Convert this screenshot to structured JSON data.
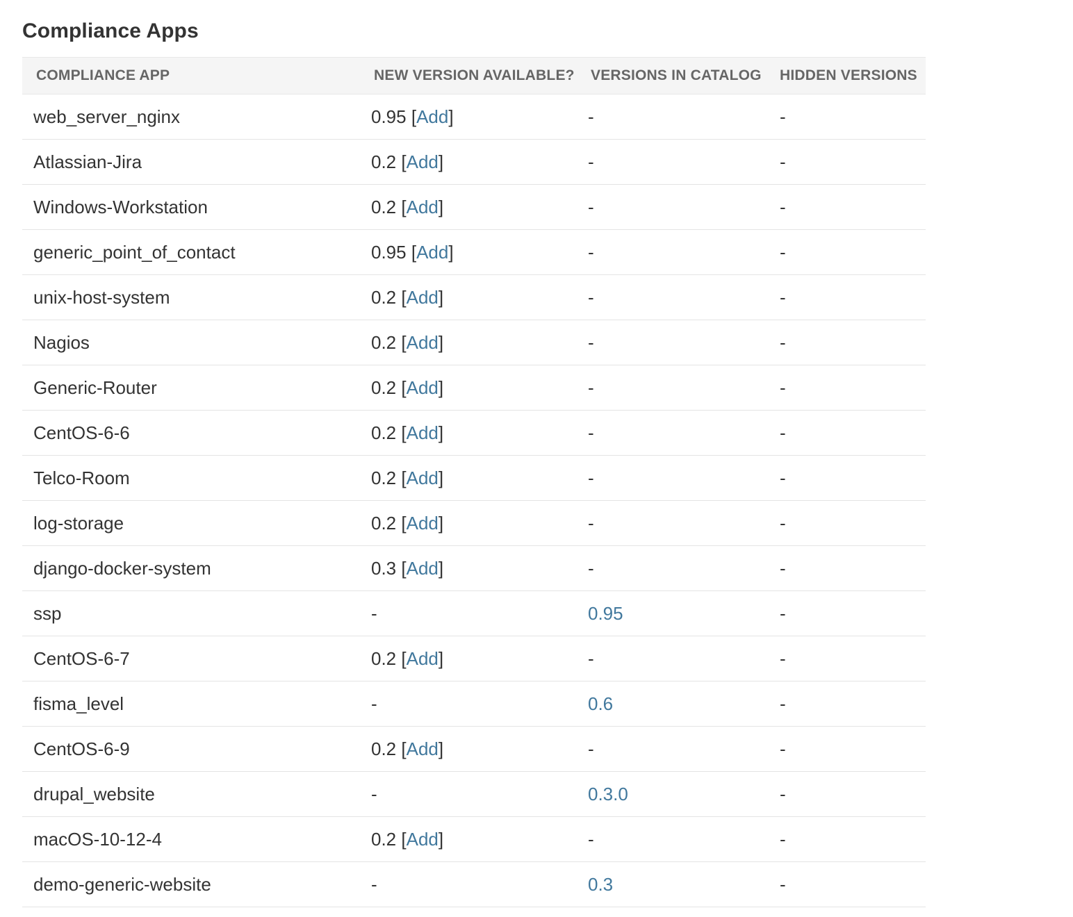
{
  "page": {
    "title": "Compliance Apps"
  },
  "table": {
    "headers": {
      "app": "COMPLIANCE APP",
      "new_version": "NEW VERSION AVAILABLE?",
      "catalog": "VERSIONS IN CATALOG",
      "hidden": "HIDDEN VERSIONS"
    },
    "rows": [
      {
        "app": "web_server_nginx",
        "new_version": "0.95",
        "add_label": "Add",
        "catalog": "-",
        "hidden": "-"
      },
      {
        "app": "Atlassian-Jira",
        "new_version": "0.2",
        "add_label": "Add",
        "catalog": "-",
        "hidden": "-"
      },
      {
        "app": "Windows-Workstation",
        "new_version": "0.2",
        "add_label": "Add",
        "catalog": "-",
        "hidden": "-"
      },
      {
        "app": "generic_point_of_contact",
        "new_version": "0.95",
        "add_label": "Add",
        "catalog": "-",
        "hidden": "-"
      },
      {
        "app": "unix-host-system",
        "new_version": "0.2",
        "add_label": "Add",
        "catalog": "-",
        "hidden": "-"
      },
      {
        "app": "Nagios",
        "new_version": "0.2",
        "add_label": "Add",
        "catalog": "-",
        "hidden": "-"
      },
      {
        "app": "Generic-Router",
        "new_version": "0.2",
        "add_label": "Add",
        "catalog": "-",
        "hidden": "-"
      },
      {
        "app": "CentOS-6-6",
        "new_version": "0.2",
        "add_label": "Add",
        "catalog": "-",
        "hidden": "-"
      },
      {
        "app": "Telco-Room",
        "new_version": "0.2",
        "add_label": "Add",
        "catalog": "-",
        "hidden": "-"
      },
      {
        "app": "log-storage",
        "new_version": "0.2",
        "add_label": "Add",
        "catalog": "-",
        "hidden": "-"
      },
      {
        "app": "django-docker-system",
        "new_version": "0.3",
        "add_label": "Add",
        "catalog": "-",
        "hidden": "-"
      },
      {
        "app": "ssp",
        "new_version": "-",
        "add_label": null,
        "catalog": "0.95",
        "hidden": "-"
      },
      {
        "app": "CentOS-6-7",
        "new_version": "0.2",
        "add_label": "Add",
        "catalog": "-",
        "hidden": "-"
      },
      {
        "app": "fisma_level",
        "new_version": "-",
        "add_label": null,
        "catalog": "0.6",
        "hidden": "-"
      },
      {
        "app": "CentOS-6-9",
        "new_version": "0.2",
        "add_label": "Add",
        "catalog": "-",
        "hidden": "-"
      },
      {
        "app": "drupal_website",
        "new_version": "-",
        "add_label": null,
        "catalog": "0.3.0",
        "hidden": "-"
      },
      {
        "app": "macOS-10-12-4",
        "new_version": "0.2",
        "add_label": "Add",
        "catalog": "-",
        "hidden": "-"
      },
      {
        "app": "demo-generic-website",
        "new_version": "-",
        "add_label": null,
        "catalog": "0.3",
        "hidden": "-"
      }
    ]
  },
  "colors": {
    "link": "#41789d",
    "text": "#333333",
    "header_text": "#666666",
    "header_bg": "#f5f5f5",
    "row_border": "#e4e4e4"
  }
}
